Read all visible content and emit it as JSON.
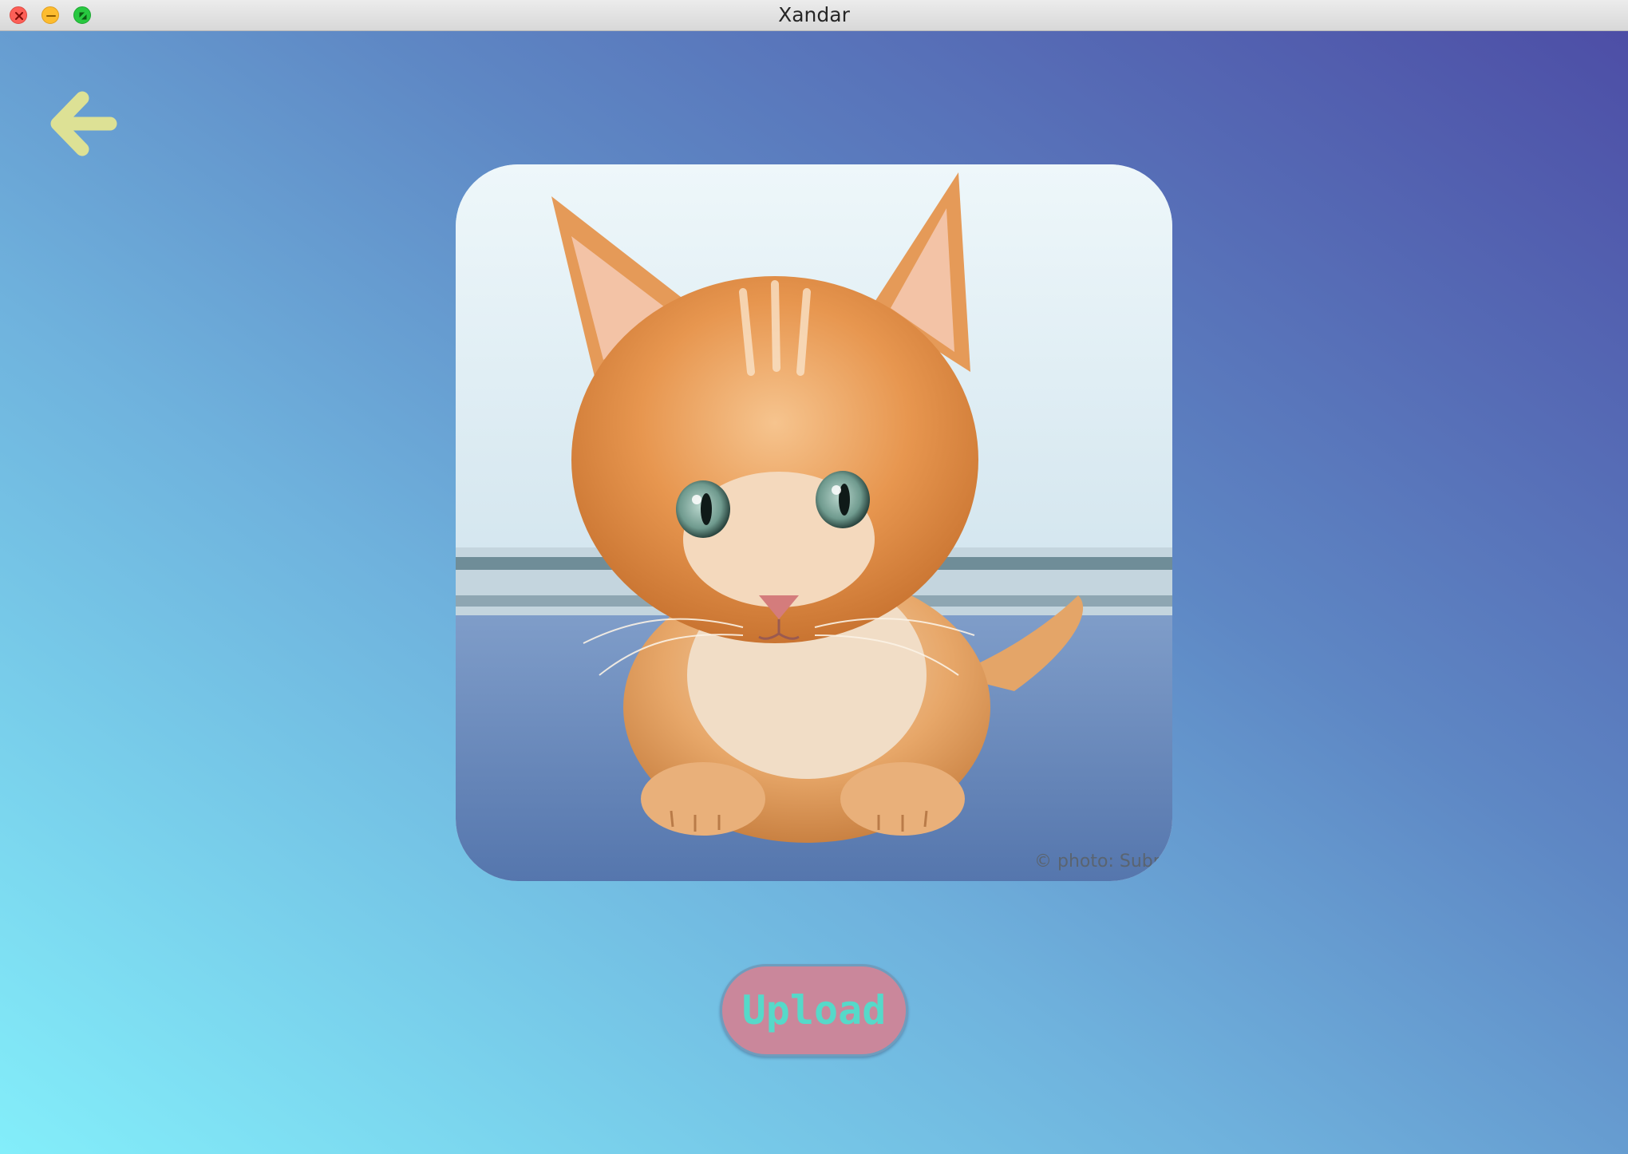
{
  "window": {
    "title": "Xandar"
  },
  "back_button": {
    "icon": "arrow-left-icon",
    "color": "#dde195"
  },
  "photo": {
    "subject": "ginger kitten on blue carpet",
    "watermark": "© photo: Subma"
  },
  "upload_button": {
    "label": "Upload",
    "background": "#ca879b",
    "text_color": "#56d9c9"
  },
  "colors": {
    "gradient_start": "#83eefa",
    "gradient_end": "#4d4ea6"
  }
}
